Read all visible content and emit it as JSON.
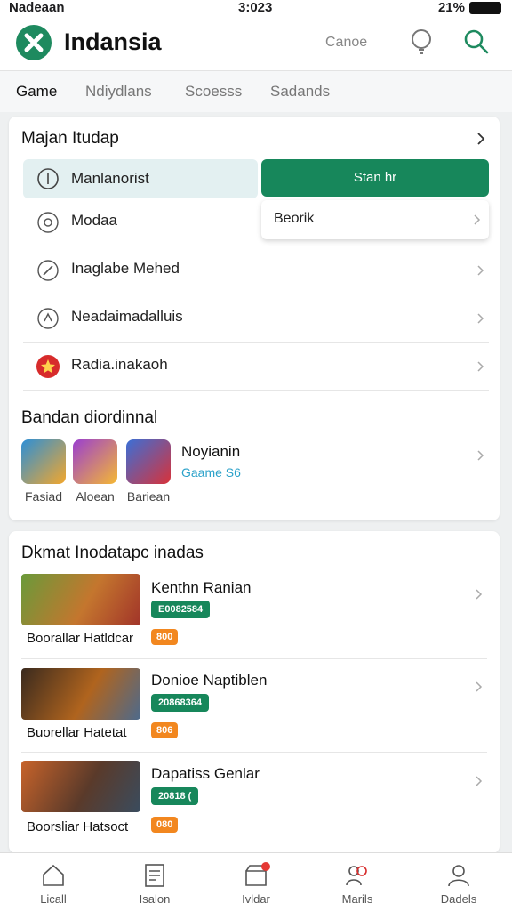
{
  "status_bar": {
    "carrier": "Nadeaan",
    "time": "3:023",
    "battery": "21%"
  },
  "app": {
    "title": "Indansia",
    "cancel_label": "Canoe"
  },
  "tabs": [
    {
      "label": "Game"
    },
    {
      "label": "Ndiydlans"
    },
    {
      "label": "Scoesss"
    },
    {
      "label": "Sadands"
    }
  ],
  "main_card": {
    "title": "Majan Itudap",
    "highlight_label": "Manlanorist",
    "green_button": "Stan hr",
    "dropdown_label": "Beorik",
    "rows": [
      {
        "label": "Modaa"
      },
      {
        "label": "Inaglabe Mehed"
      },
      {
        "label": "Neadaimadalluis"
      },
      {
        "label": "Radia.inakaoh"
      }
    ]
  },
  "games_section": {
    "title": "Bandan diordinnal",
    "games": [
      {
        "caption": "Fasiad"
      },
      {
        "caption": "Aloean"
      },
      {
        "caption": "Bariean"
      }
    ],
    "featured_title": "Noyianin",
    "featured_sub": "Gaame S6"
  },
  "promos": {
    "title": "Dkmat Inodatapc inadas",
    "items": [
      {
        "title": "Kenthn Ranian",
        "badge": "E0082584",
        "tag": "800",
        "caption": "Boorallar Hatldcar"
      },
      {
        "title": "Donioe Naptiblen",
        "badge": "20868364",
        "tag": "806",
        "caption": "Buorellar Hatetat"
      },
      {
        "title": "Dapatiss Genlar",
        "badge": "20818 (",
        "tag": "080",
        "caption": "Boorsliar Hatsoct"
      }
    ]
  },
  "bottom_nav": [
    {
      "label": "Licall"
    },
    {
      "label": "Isalon"
    },
    {
      "label": "Ivldar"
    },
    {
      "label": "Marils"
    },
    {
      "label": "Dadels"
    }
  ],
  "colors": {
    "accent": "#17875b",
    "orange": "#f2871f",
    "link": "#2aa1c9"
  }
}
